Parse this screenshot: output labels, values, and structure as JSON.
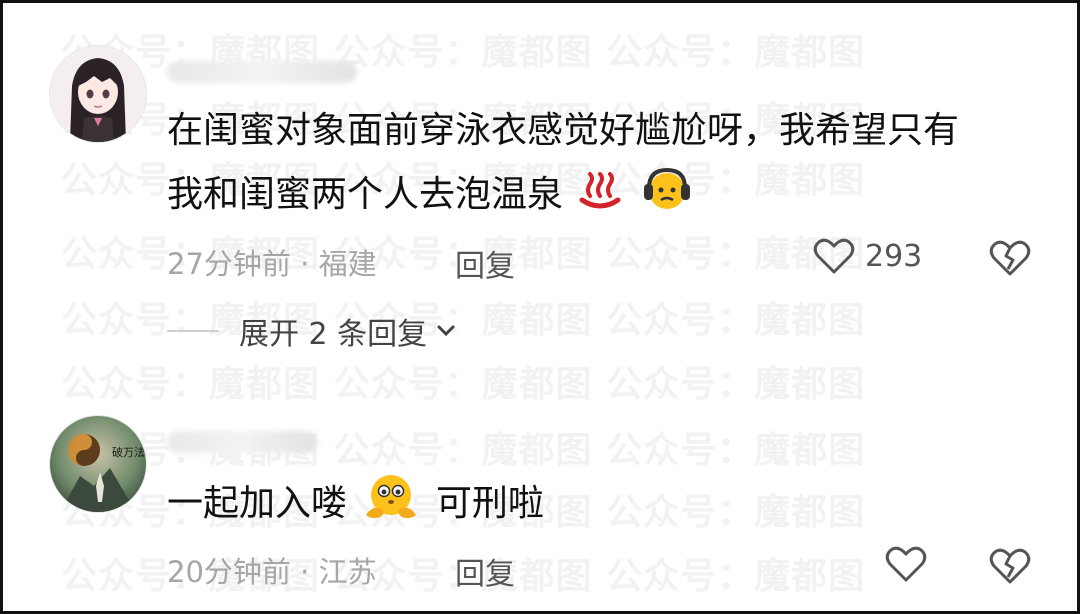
{
  "watermark": {
    "text": "公众号：魔都图",
    "rows": [
      "公众号：魔都图  公众号：魔都图  公众号：魔都图"
    ]
  },
  "comments": [
    {
      "username_blurred": true,
      "text_line1": "在闺蜜对象面前穿泳衣感觉好尴尬呀，我希望只有",
      "text_line2": "我和闺蜜两个人去泡温泉",
      "emojis": [
        "hot-springs-icon",
        "headphones-face-icon"
      ],
      "time": "27分钟前",
      "location": "福建",
      "meta_sep": " · ",
      "reply_label": "回复",
      "like_count": "293",
      "expand_label": "展开 2 条回复"
    },
    {
      "username_blurred": true,
      "text_before": "一起加入喽",
      "text_after": "可刑啦",
      "emojis": [
        "shy-face-icon"
      ],
      "time": "20分钟前",
      "location": "江苏",
      "meta_sep": " · ",
      "reply_label": "回复",
      "like_count": ""
    }
  ],
  "avatar2_text": "破万法",
  "colors": {
    "text": "#111111",
    "meta": "#a6a6a6",
    "icon": "#555555",
    "frame": "#111111"
  }
}
